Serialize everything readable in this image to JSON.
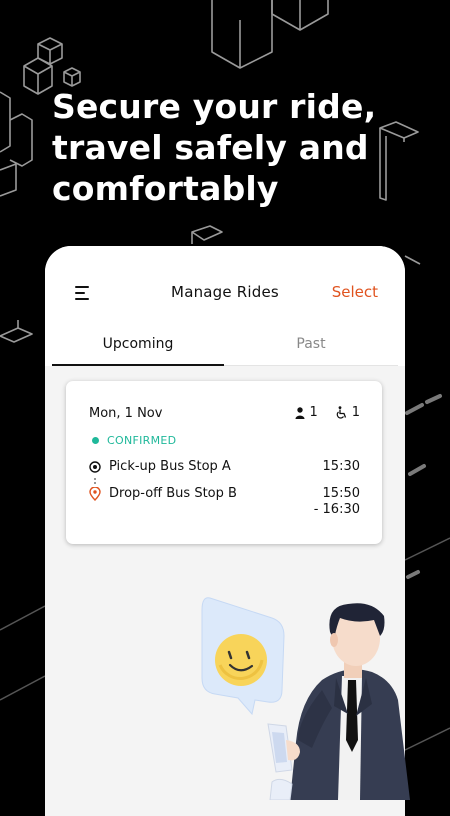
{
  "headline": {
    "line1": "Secure your ride,",
    "line2": "travel safely and",
    "line3": "comfortably"
  },
  "app_bar": {
    "title": "Manage Rides",
    "select_label": "Select"
  },
  "tabs": [
    {
      "label": "Upcoming",
      "active": true
    },
    {
      "label": "Past",
      "active": false
    }
  ],
  "ride": {
    "date": "Mon, 1 Nov",
    "passengers": "1",
    "wheelchairs": "1",
    "status": "CONFIRMED",
    "pickup": {
      "label": "Pick-up Bus Stop A",
      "time": "15:30"
    },
    "dropoff": {
      "label": "Drop-off Bus Stop B",
      "time_start": "15:50",
      "time_end": "- 16:30"
    }
  },
  "colors": {
    "background": "#000000",
    "accent": "#e0531f",
    "confirmed": "#1fb89a",
    "card": "#ffffff"
  },
  "icons": [
    "menu-icon",
    "person-icon",
    "wheelchair-icon",
    "pickup-target-icon",
    "dropoff-pin-icon",
    "smiley-icon"
  ]
}
